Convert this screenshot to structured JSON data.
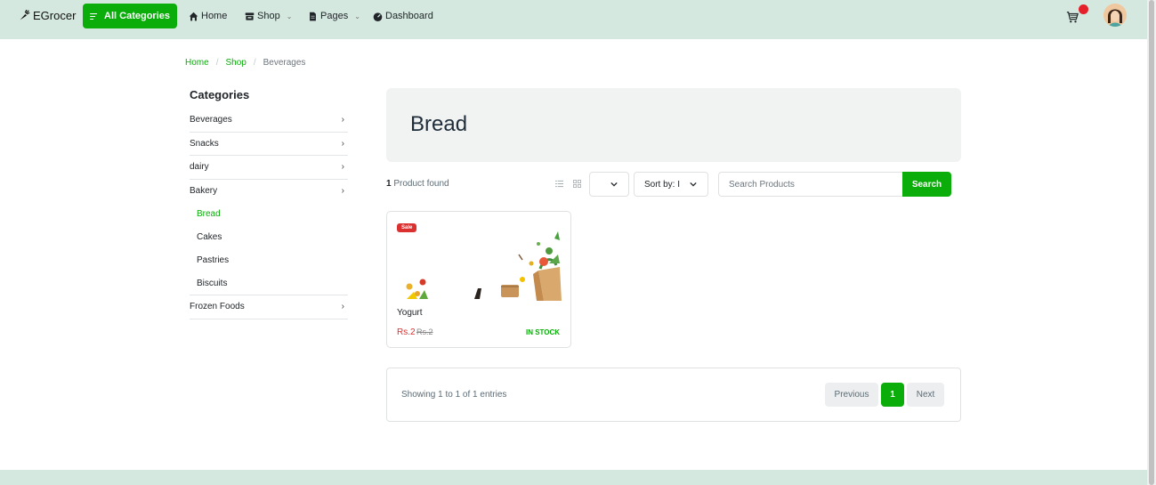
{
  "nav": {
    "brand": "EGrocer",
    "all_categories": "All Categories",
    "home": "Home",
    "shop": "Shop",
    "pages": "Pages",
    "dashboard": "Dashboard"
  },
  "breadcrumb": {
    "home": "Home",
    "separator": "/",
    "shop": "Shop",
    "current": "Beverages"
  },
  "sidebar": {
    "title": "Categories",
    "categories": [
      {
        "label": "Beverages"
      },
      {
        "label": "Snacks"
      },
      {
        "label": "dairy"
      },
      {
        "label": "Bakery"
      },
      {
        "label": "Frozen Foods"
      }
    ],
    "subcategories": [
      {
        "label": "Bread"
      },
      {
        "label": "Cakes"
      },
      {
        "label": "Pastries"
      },
      {
        "label": "Biscuits"
      }
    ],
    "arrow": "›"
  },
  "hero": {
    "title": "Bread"
  },
  "toolbar": {
    "count": "1",
    "count_label": " Product found",
    "sort_label": "Sort by: I",
    "search_placeholder": "Search Products",
    "search_button": "Search"
  },
  "products": [
    {
      "badge": "Sale",
      "name": "Yogurt",
      "price": "Rs.2",
      "old_price": "Rs.2",
      "stock": "IN STOCK"
    }
  ],
  "pagination": {
    "info": "Showing 1 to 1 of 1 entries",
    "previous": "Previous",
    "page": "1",
    "next": "Next"
  },
  "colors": {
    "brand_green": "#0aad0a",
    "nav_bg": "#d4e8df",
    "sale_red": "#db3030",
    "cart_dot": "#e5202a"
  },
  "icons": {
    "brand": "carrot-icon",
    "menu": "menu-lines-icon",
    "home": "home-icon",
    "shop": "store-icon",
    "pages": "file-icon",
    "dashboard": "gauge-icon",
    "cart": "cart-icon",
    "list_view": "list-view-icon",
    "grid_view": "grid-view-icon"
  }
}
